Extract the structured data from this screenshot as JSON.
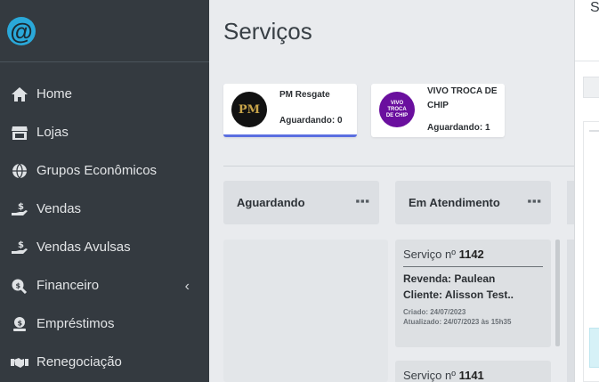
{
  "sidebar": {
    "logo_glyph": "@",
    "items": [
      {
        "label": "Home",
        "icon": "home-icon"
      },
      {
        "label": "Lojas",
        "icon": "store-icon"
      },
      {
        "label": "Grupos Econômicos",
        "icon": "globe-icon"
      },
      {
        "label": "Vendas",
        "icon": "hand-dollar-icon"
      },
      {
        "label": "Vendas Avulsas",
        "icon": "hand-dollar-icon"
      },
      {
        "label": "Financeiro",
        "icon": "search-dollar-icon",
        "has_caret": true
      },
      {
        "label": "Empréstimos",
        "icon": "money-user-icon"
      },
      {
        "label": "Renegociação",
        "icon": "handshake-icon"
      }
    ]
  },
  "main": {
    "title": "Serviços",
    "services": [
      {
        "name": "PM Resgate",
        "status": "Aguardando: 0",
        "avatar_text": "PM",
        "avatar_bg": "#121212",
        "avatar_fg": "#c9a54a"
      },
      {
        "name": "VIVO TROCA DE CHIP",
        "status": "Aguardando: 1",
        "avatar_text": "VIVO TROCA DE CHIP",
        "avatar_bg": "#6a0f9e",
        "avatar_fg": "#ffffff"
      }
    ],
    "columns": [
      {
        "title": "Aguardando",
        "menu_glyph": "⋮"
      },
      {
        "title": "Em Atendimento",
        "menu_glyph": "⋮"
      }
    ],
    "tickets": [
      {
        "label": "Serviço nº",
        "number": "1142",
        "revenda": "Revenda: Paulean",
        "cliente": "Cliente: Alisson Test..",
        "criado": "Criado: 24/07/2023",
        "atualizado": "Atualizado: 24/07/2023 às 15h35"
      },
      {
        "label": "Serviço nº",
        "number": "1141"
      }
    ]
  },
  "panel": {
    "title_fragment": "S"
  },
  "colors": {
    "sidebar_bg": "#343a40",
    "accent": "#5a6ee0",
    "logo": "#2aa8d9"
  }
}
